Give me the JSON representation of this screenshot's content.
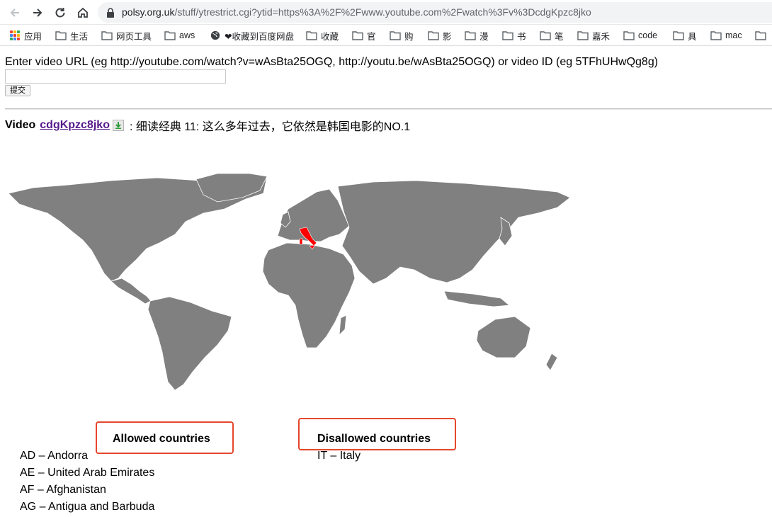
{
  "browser": {
    "url_host": "polsy.org.uk",
    "url_rest": "/stuff/ytrestrict.cgi?ytid=https%3A%2F%2Fwww.youtube.com%2Fwatch%3Fv%3DcdgKpzc8jko"
  },
  "bookmarks": [
    "应用",
    "生活",
    "网页工具",
    "aws",
    "❤收藏到百度网盘",
    "收藏",
    "官",
    "购",
    "影",
    "漫",
    "书",
    "笔",
    "嘉禾",
    "code",
    "具",
    "mac"
  ],
  "form": {
    "prompt": "Enter video URL (eg http://youtube.com/watch?v=wAsBta25OGQ, http://youtu.be/wAsBta25OGQ) or video ID (eg 5TFhUHwQg8g)",
    "input_value": "",
    "submit_label": "提交"
  },
  "video": {
    "label": "Video",
    "id": "cdgKpzc8jko",
    "title": ": 细读经典 11: 这么多年过去，它依然是韩国电影的NO.1"
  },
  "map": {
    "land_color": "#808080",
    "highlight_color": "#ff0000",
    "highlighted_country": "Italy"
  },
  "allowed": {
    "title": "Allowed countries",
    "items": [
      "AD – Andorra",
      "AE – United Arab Emirates",
      "AF – Afghanistan",
      "AG – Antigua and Barbuda"
    ]
  },
  "disallowed": {
    "title": "Disallowed countries",
    "items": [
      "IT – Italy"
    ]
  },
  "colors": {
    "highlight_box": "#e5472d",
    "visited_link": "#551a8b"
  }
}
